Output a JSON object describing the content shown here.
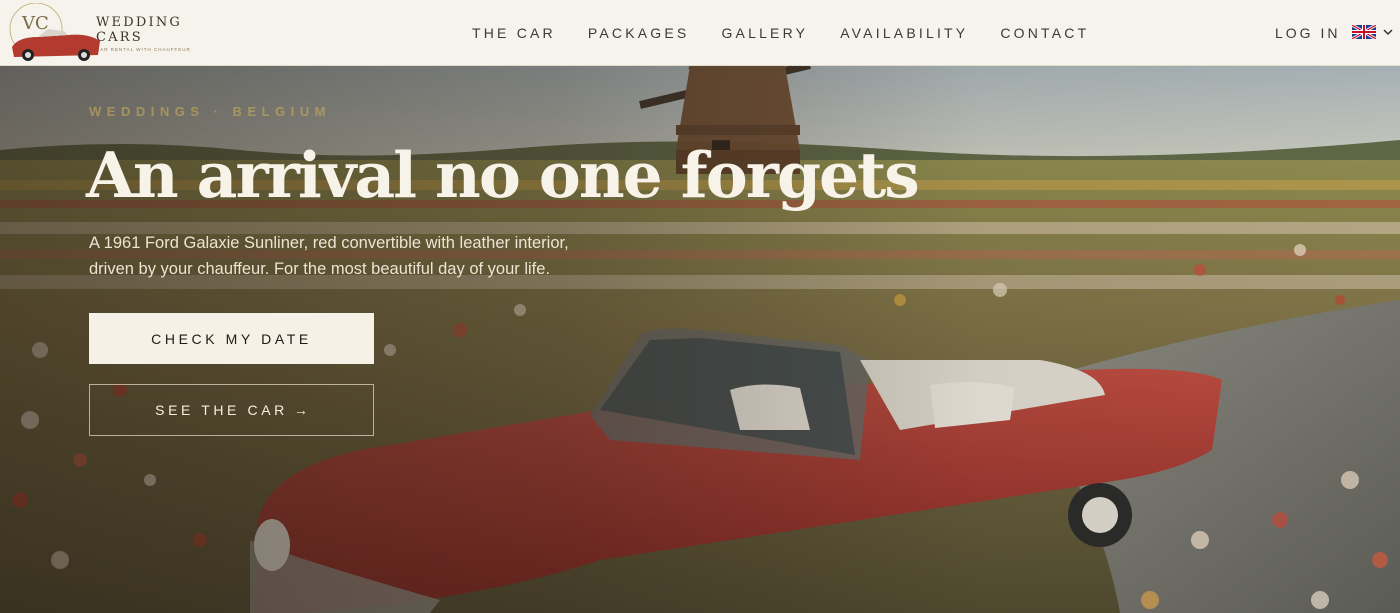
{
  "header": {
    "logo": {
      "monogram": "VC",
      "title": "WEDDING CARS",
      "subtitle": "CAR RENTAL WITH CHAUFFEUR"
    },
    "nav": [
      {
        "label": "THE CAR"
      },
      {
        "label": "PACKAGES"
      },
      {
        "label": "GALLERY"
      },
      {
        "label": "AVAILABILITY"
      },
      {
        "label": "CONTACT"
      }
    ],
    "login_label": "LOG IN",
    "language_icon": "uk-flag-icon",
    "language_chevron": "chevron-down-icon"
  },
  "hero": {
    "eyebrow": "WEDDINGS · BELGIUM",
    "headline": "An arrival no one forgets",
    "lead_line1": "A 1961 Ford Galaxie Sunliner, red convertible with leather interior,",
    "lead_line2": "driven by your chauffeur. For the most beautiful day of your life.",
    "primary_button": "CHECK MY DATE",
    "secondary_button": "SEE THE CAR",
    "secondary_arrow": "→"
  },
  "colors": {
    "header_bg": "#f6f3ec",
    "primary_button_bg": "#f6f1e6",
    "headline": "#f8f3e8",
    "eyebrow": "#d4b45a",
    "car_red": "#a8332c"
  }
}
